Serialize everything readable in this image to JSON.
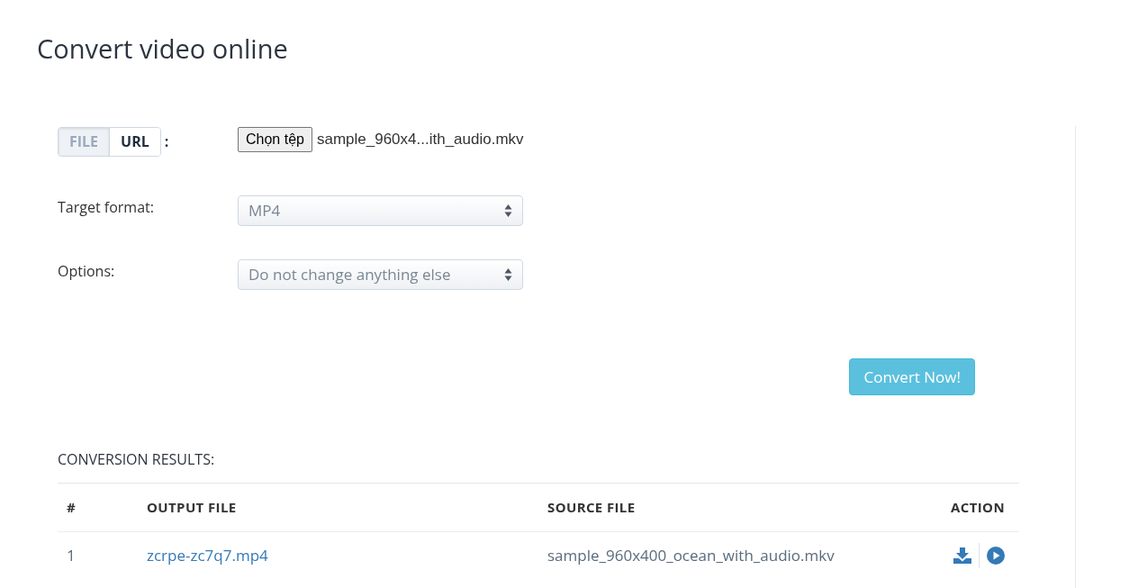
{
  "title": "Convert video online",
  "source_tabs": [
    {
      "label": "FILE",
      "selected": true
    },
    {
      "label": "URL",
      "selected": false
    }
  ],
  "source_colon": ":",
  "file_input": {
    "button": "Chọn tệp",
    "filename": "sample_960x4...ith_audio.mkv"
  },
  "fields": [
    {
      "label": "Target format:",
      "value": "MP4"
    },
    {
      "label": "Options:",
      "value": "Do not change anything else"
    }
  ],
  "convert_button": "Convert Now!",
  "results": {
    "heading": "CONVERSION RESULTS:",
    "columns": [
      "#",
      "OUTPUT FILE",
      "SOURCE FILE",
      "ACTION"
    ],
    "rows": [
      {
        "index": "1",
        "output": "zcrpe-zc7q7.mp4",
        "source": "sample_960x400_ocean_with_audio.mkv"
      }
    ]
  }
}
